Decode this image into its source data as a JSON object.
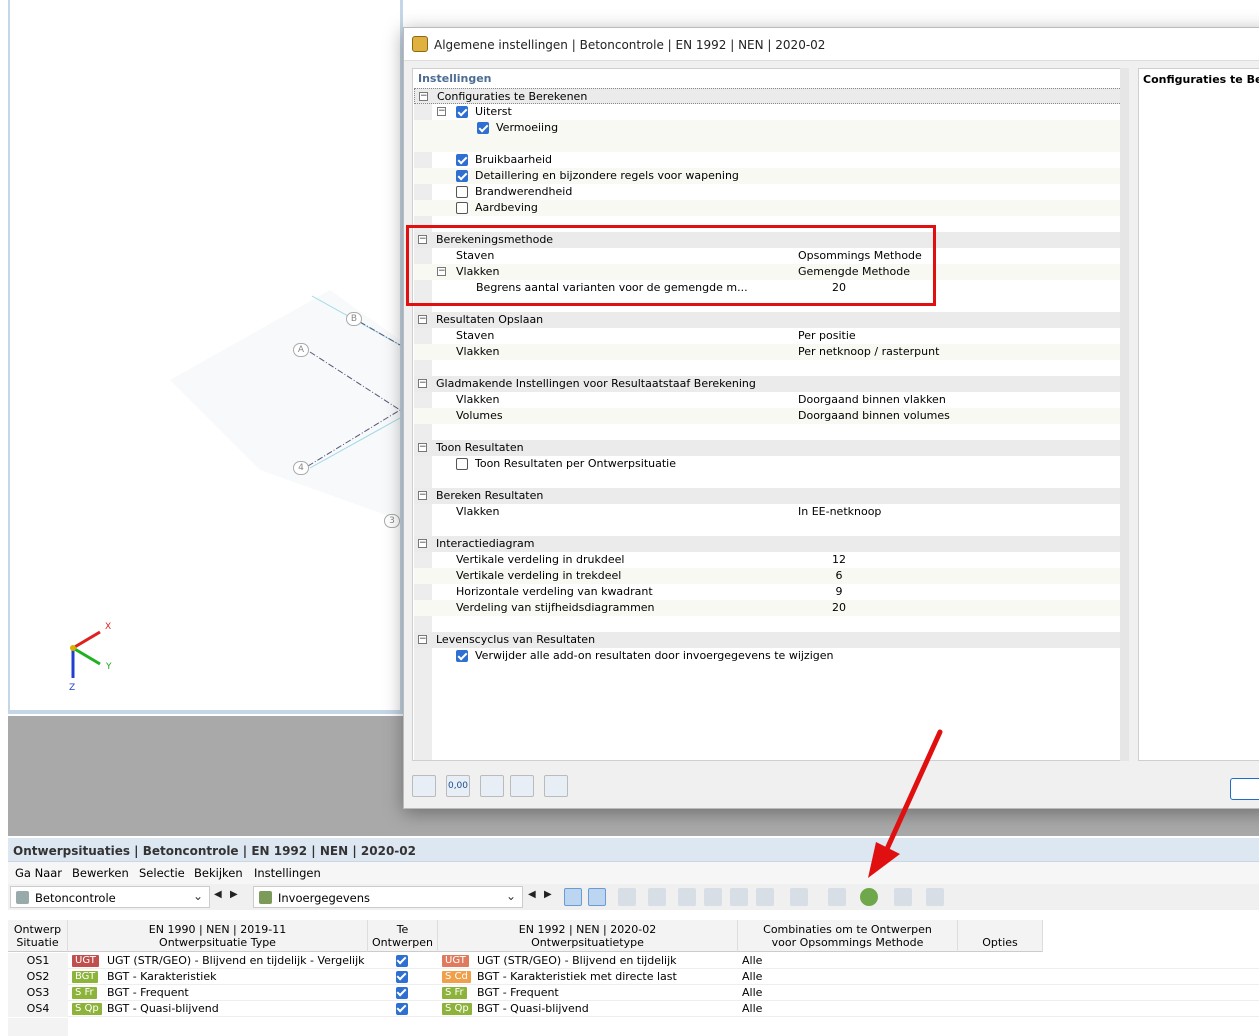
{
  "dialog": {
    "title": "Algemene instellingen | Betoncontrole | EN 1992 | NEN | 2020-02",
    "tree_header": "Instellingen",
    "right_panel_header": "Configuraties te Berekenen",
    "sections": {
      "config": {
        "label": "Configuraties te Berekenen",
        "uiterst": "Uiterst",
        "vermoeiing": "Vermoeiing",
        "bruikbaarheid": "Bruikbaarheid",
        "detaillering": "Detaillering en bijzondere regels voor wapening",
        "brandwerendheid": "Brandwerendheid",
        "aardbeving": "Aardbeving"
      },
      "method": {
        "label": "Berekeningsmethode",
        "staven": "Staven",
        "staven_val": "Opsommings Methode",
        "vlakken": "Vlakken",
        "vlakken_val": "Gemengde Methode",
        "begrens": "Begrens aantal varianten voor de gemengde m...",
        "begrens_val": "20"
      },
      "opslaan": {
        "label": "Resultaten Opslaan",
        "staven": "Staven",
        "staven_val": "Per positie",
        "vlakken": "Vlakken",
        "vlakken_val": "Per netknoop / rasterpunt"
      },
      "glad": {
        "label": "Gladmakende Instellingen voor Resultaatstaaf Berekening",
        "vlakken": "Vlakken",
        "vlakken_val": "Doorgaand binnen vlakken",
        "volumes": "Volumes",
        "volumes_val": "Doorgaand binnen volumes"
      },
      "toon": {
        "label": "Toon Resultaten",
        "per_os": "Toon Resultaten per Ontwerpsituatie"
      },
      "bereken": {
        "label": "Bereken Resultaten",
        "vlakken": "Vlakken",
        "vlakken_val": "In EE-netknoop"
      },
      "interactie": {
        "label": "Interactiediagram",
        "druk": "Vertikale verdeling in drukdeel",
        "druk_val": "12",
        "trek": "Vertikale verdeling in trekdeel",
        "trek_val": "6",
        "kwadrant": "Horizontale verdeling van kwadrant",
        "kwadrant_val": "9",
        "stijf": "Verdeling van stijfheidsdiagrammen",
        "stijf_val": "20"
      },
      "leven": {
        "label": "Levenscyclus van Resultaten",
        "verwijder": "Verwijder alle add-on resultaten door invoergegevens te wijzigen"
      }
    },
    "toolbar_value": "0,00"
  },
  "viewport": {
    "nodes": [
      "B",
      "A",
      "4",
      "3"
    ],
    "axes": {
      "x": "X",
      "y": "Y",
      "z": "Z"
    }
  },
  "bottom": {
    "title": "Ontwerpsituaties | Betoncontrole | EN 1992 | NEN | 2020-02",
    "menu": [
      "Ga Naar",
      "Bewerken",
      "Selectie",
      "Bekijken",
      "Instellingen"
    ],
    "combo1": "Betoncontrole",
    "combo2": "Invoergegevens",
    "headers": {
      "os": "Ontwerp\nSituatie",
      "type_top": "EN 1990 | NEN | 2019-11",
      "type_bottom": "Ontwerpsituatie Type",
      "te_top": "Te",
      "te_bottom": "Ontwerpen",
      "type2_top": "EN 1992 | NEN | 2020-02",
      "type2_bottom": "Ontwerpsituatietype",
      "comb_top": "Combinaties om te Ontwerpen",
      "comb_bottom": "voor Opsommings Methode",
      "opties": "Opties"
    },
    "rows": [
      {
        "id": "OS1",
        "badge1": "UGT",
        "c1": "#c0504d",
        "type1": "UGT (STR/GEO) - Blijvend en tijdelijk - Vergelijkin...",
        "badge2": "UGT",
        "c2": "#e07a5f",
        "type2": "UGT (STR/GEO) - Blijvend en tijdelijk",
        "comb": "Alle"
      },
      {
        "id": "OS2",
        "badge1": "BGT",
        "c1": "#8db33a",
        "type1": "BGT - Karakteristiek",
        "badge2": "S Cd",
        "c2": "#f0a04b",
        "type2": "BGT - Karakteristiek met directe last",
        "comb": "Alle"
      },
      {
        "id": "OS3",
        "badge1": "S Fr",
        "c1": "#8db33a",
        "type1": "BGT - Frequent",
        "badge2": "S Fr",
        "c2": "#8db33a",
        "type2": "BGT - Frequent",
        "comb": "Alle"
      },
      {
        "id": "OS4",
        "badge1": "S Qp",
        "c1": "#8db33a",
        "type1": "BGT - Quasi-blijvend",
        "badge2": "S Qp",
        "c2": "#8db33a",
        "type2": "BGT - Quasi-blijvend",
        "comb": "Alle"
      }
    ]
  }
}
